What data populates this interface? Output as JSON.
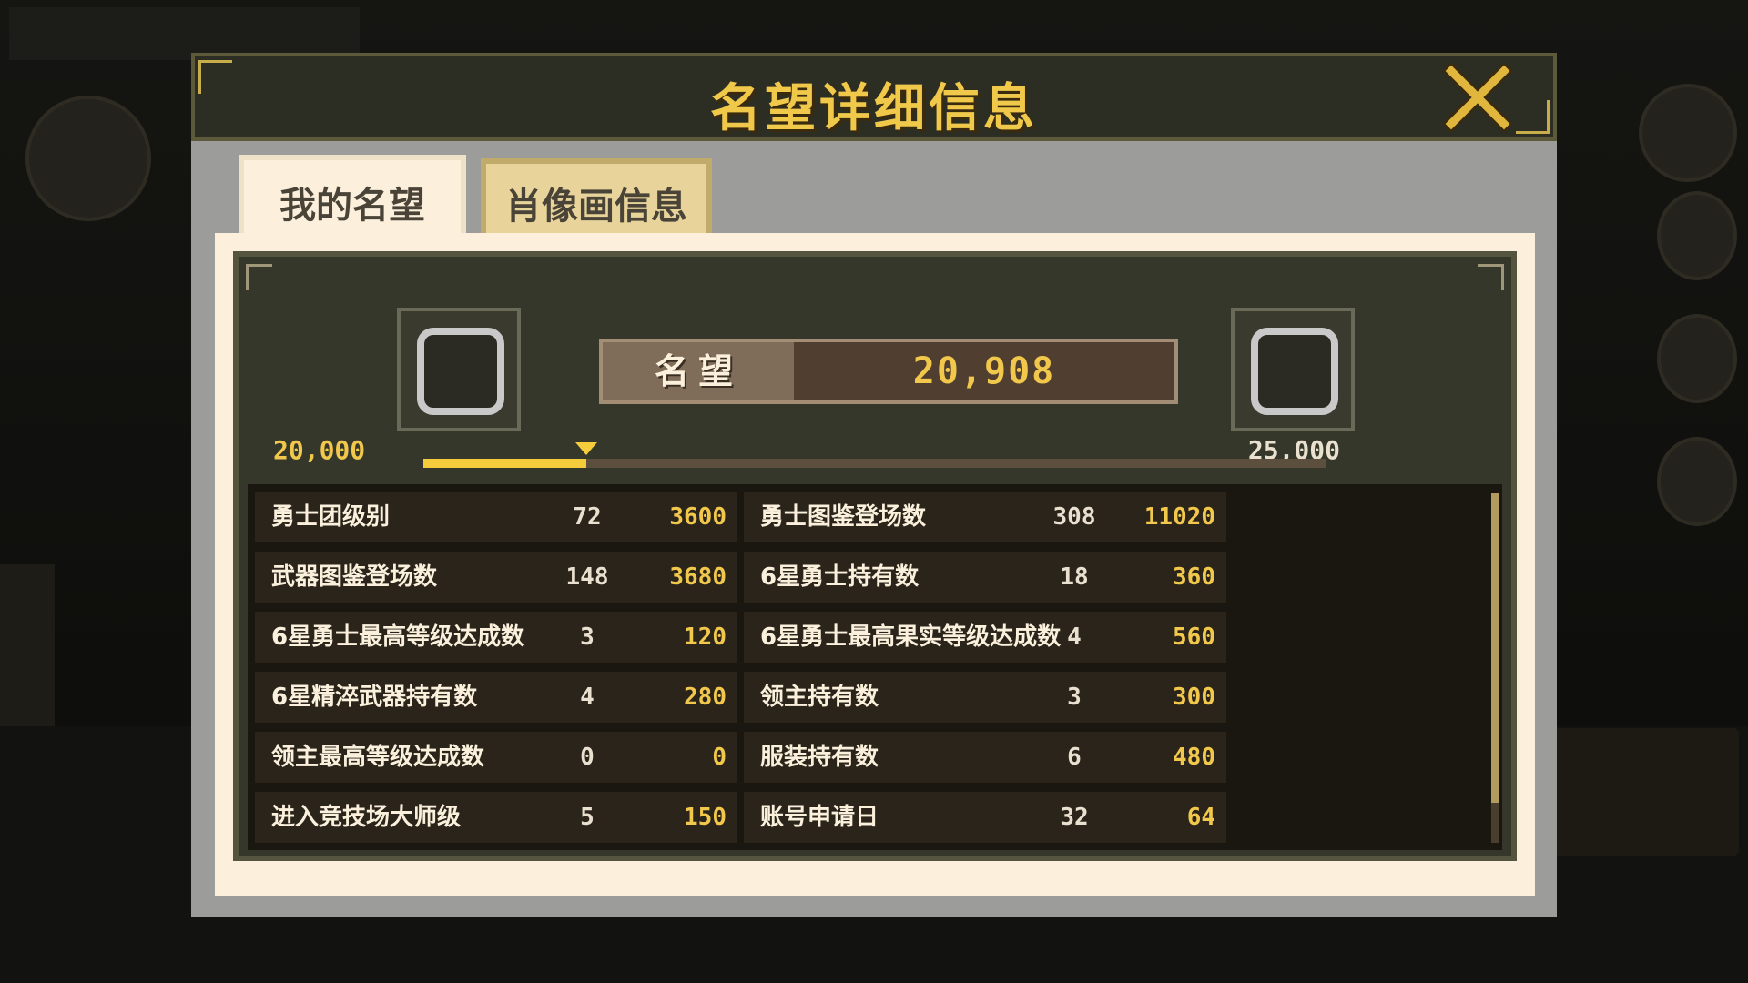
{
  "dialog": {
    "title": "名望详细信息",
    "tabs": [
      {
        "label": "我的名望",
        "active": true
      },
      {
        "label": "肖像画信息",
        "active": false
      }
    ]
  },
  "reputation": {
    "label": "名望",
    "value": "20,908",
    "range_min": "20,000",
    "range_max": "25,000",
    "progress_fraction": 0.18
  },
  "stats_left": [
    {
      "name": "勇士团级别",
      "count": "72",
      "points": "3600"
    },
    {
      "name": "武器图鉴登场数",
      "count": "148",
      "points": "3680"
    },
    {
      "name": "6星勇士最高等级达成数",
      "count": "3",
      "points": "120"
    },
    {
      "name": "6星精淬武器持有数",
      "count": "4",
      "points": "280"
    },
    {
      "name": "领主最高等级达成数",
      "count": "0",
      "points": "0"
    },
    {
      "name": "进入竞技场大师级",
      "count": "5",
      "points": "150"
    }
  ],
  "stats_right": [
    {
      "name": "勇士图鉴登场数",
      "count": "308",
      "points": "11020"
    },
    {
      "name": "6星勇士持有数",
      "count": "18",
      "points": "360"
    },
    {
      "name": "6星勇士最高果实等级达成数",
      "count": "4",
      "points": "560"
    },
    {
      "name": "领主持有数",
      "count": "3",
      "points": "300"
    },
    {
      "name": "服装持有数",
      "count": "6",
      "points": "480"
    },
    {
      "name": "账号申请日",
      "count": "32",
      "points": "64"
    }
  ],
  "colors": {
    "gold": "#f2c84c",
    "panel": "#36372b",
    "parchment": "#fcefdc",
    "progress": "#f5cc3c"
  },
  "icons": {
    "close": "close-x-icon",
    "frame_left": "portrait-frame-icon",
    "frame_right": "portrait-frame-icon"
  }
}
